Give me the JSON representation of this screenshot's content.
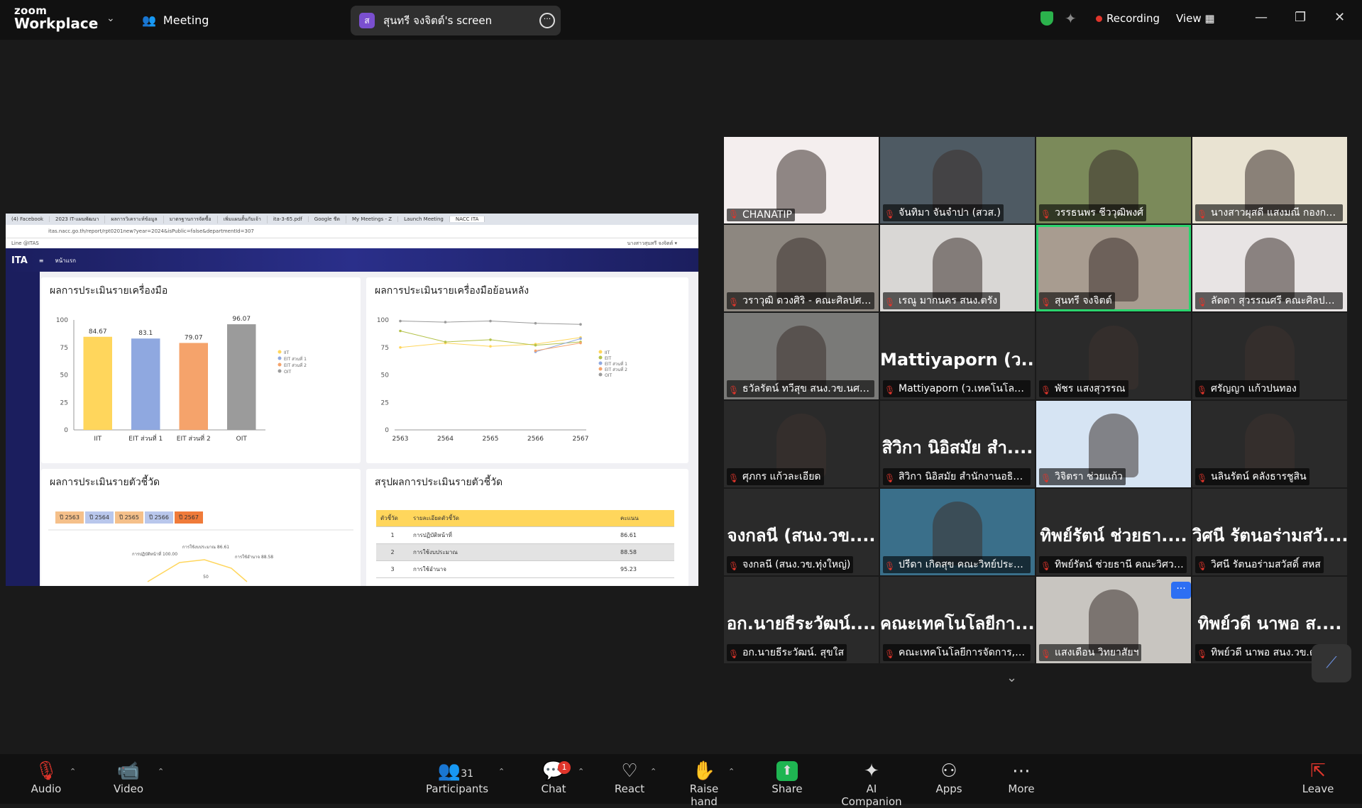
{
  "app": {
    "logo_top": "zoom",
    "logo_bottom": "Workplace",
    "meeting_label": "Meeting"
  },
  "screen_share": {
    "avatar": "ส",
    "title": "สุนทรี จงจิตต์'s screen"
  },
  "header_right": {
    "recording": "Recording",
    "view": "View"
  },
  "browser": {
    "tabs": [
      "(4) Facebook",
      "2023 IT-แผนพัฒนา",
      "ผลการวิเคราะห์ข้อมูล",
      "มาตรฐานการจัดซื้อ",
      "เพิ่มแผนสั้นกับเจ้า",
      "ita-3-65.pdf",
      "Google ชีต",
      "My Meetings - Z",
      "Launch Meeting",
      "NACC ITA"
    ],
    "url": "itas.nacc.go.th/report/rpt0201new?year=2024&isPublic=false&departmentId=307",
    "bookmark": "Line @ITAS",
    "user": "นางสาวสุนทรี จงจิตต์ ▾",
    "nav_home": "หน้าแรก",
    "logo": "ITA"
  },
  "cards": {
    "c1_title": "ผลการประเมินรายเครื่องมือ",
    "c2_title": "ผลการประเมินรายเครื่องมือย้อนหลัง",
    "c3_title": "ผลการประเมินรายตัวชี้วัด",
    "c4_title": "สรุปผลการประเมินรายตัวชี้วัด"
  },
  "chart_data": [
    {
      "type": "bar",
      "categories": [
        "IIT",
        "EIT ส่วนที่ 1",
        "EIT ส่วนที่ 2",
        "OIT"
      ],
      "values": [
        84.67,
        83.1,
        79.07,
        96.07
      ],
      "colors": [
        "#ffd65c",
        "#8fa8e0",
        "#f5a36b",
        "#9b9b9b"
      ],
      "legend": [
        "IIT",
        "EIT ส่วนที่ 1",
        "EIT ส่วนที่ 2",
        "OIT"
      ],
      "yticks": [
        0,
        25,
        50,
        75,
        100
      ],
      "ylim": [
        0,
        100
      ]
    },
    {
      "type": "line",
      "x": [
        "2563",
        "2564",
        "2565",
        "2566",
        "2567"
      ],
      "series": [
        {
          "name": "IIT",
          "values": [
            75,
            79,
            76,
            78,
            84
          ],
          "color": "#ffd65c"
        },
        {
          "name": "EIT",
          "values": [
            90,
            80,
            82,
            77,
            80
          ],
          "color": "#b4c24a"
        },
        {
          "name": "EIT ส่วนที่ 1",
          "values": [
            null,
            null,
            null,
            71,
            83
          ],
          "color": "#8fa8e0"
        },
        {
          "name": "EIT ส่วนที่ 2",
          "values": [
            null,
            null,
            null,
            72,
            79
          ],
          "color": "#f5a36b"
        },
        {
          "name": "OIT",
          "values": [
            99,
            98,
            99,
            97,
            96
          ],
          "color": "#9b9b9b"
        }
      ],
      "yticks": [
        0,
        25,
        50,
        75,
        100
      ],
      "ylim": [
        0,
        100
      ]
    }
  ],
  "year_buttons": [
    {
      "label": "ปี 2563",
      "color": "#f5c08a"
    },
    {
      "label": "ปี 2564",
      "color": "#b9c7ec"
    },
    {
      "label": "ปี 2565",
      "color": "#f5c08a"
    },
    {
      "label": "ปี 2566",
      "color": "#b9c7ec"
    },
    {
      "label": "ปี 2567",
      "color": "#f07b3a"
    }
  ],
  "radar_labels": [
    "การปฏิบัติหน้าที่ 100.00",
    "การใช้งบประมาณ 86.61",
    "การใช้อำนาจ 88.58",
    "50"
  ],
  "summary_table": {
    "headers": [
      "ตัวชี้วัด",
      "รายละเอียดตัวชี้วัด",
      "คะแนน"
    ],
    "rows": [
      [
        "1",
        "การปฏิบัติหน้าที่",
        "86.61"
      ],
      [
        "2",
        "การใช้งบประมาณ",
        "88.58"
      ],
      [
        "3",
        "การใช้อำนาจ",
        "95.23"
      ]
    ]
  },
  "participants": [
    {
      "name": "CHANATIP",
      "big": "",
      "bg": "#f4eeee"
    },
    {
      "name": "จันทิมา จันจำปา (สวส.)",
      "big": "",
      "bg": "#4e5a63"
    },
    {
      "name": "วรรธนพร ชีววุฒิพงศ์",
      "big": "",
      "bg": "#7b8a5a"
    },
    {
      "name": "นางสาวผุสดี แสงมณี กองกลาง",
      "big": "",
      "bg": "#e9e3d2"
    },
    {
      "name": "วราวุฒิ ดวงศิริ - คณะศิลปศาส...",
      "big": "",
      "bg": "#8d8780"
    },
    {
      "name": "เรณู มากนคร สนง.ตรัง",
      "big": "",
      "bg": "#d9d7d5"
    },
    {
      "name": "สุนทรี จงจิตต์",
      "big": "",
      "bg": "#a89c90"
    },
    {
      "name": "ลัดดา สุวรรณศรี คณะศิลปศา...",
      "big": "",
      "bg": "#e8e4e4"
    },
    {
      "name": "ธวัลรัตน์ ทวีสุข สนง.วข.นศ. ไ...",
      "big": "",
      "bg": "#7a7a78"
    },
    {
      "name": "Mattiyaporn (ว.เทคโนโลยีอุ...",
      "big": "Mattiyaporn (ว....",
      "bg": "#2a2a2a"
    },
    {
      "name": "พัชร แสงสุวรรณ",
      "big": "",
      "bg": "#2a2a2a"
    },
    {
      "name": "ศรัญญา แก้วปนทอง",
      "big": "",
      "bg": "#2a2a2a"
    },
    {
      "name": "ศุภกร แก้วละเอียด",
      "big": "",
      "bg": "#2a2a2a"
    },
    {
      "name": "สิวิกา นิอิสมัย สำนักงานอธิการ...",
      "big": "สิวิกา นิอิสมัย สำ....",
      "bg": "#2a2a2a"
    },
    {
      "name": "วิจิตรา ช่วยแก้ว",
      "big": "",
      "bg": "#d6e4f3"
    },
    {
      "name": "นลินรัตน์ คลังธารชูสิน",
      "big": "",
      "bg": "#2a2a2a"
    },
    {
      "name": "จงกลนี (สนง.วข.ทุ่งใหญ่)",
      "big": "จงกลนี (สนง.วข....",
      "bg": "#2a2a2a"
    },
    {
      "name": "ปรีดา เกิดสุข คณะวิทย์ประมง ...",
      "big": "",
      "bg": "#3a6f8a"
    },
    {
      "name": "ทิพย์รัตน์ ช่วยธานี คณะวิศวกร...",
      "big": "ทิพย์รัตน์ ช่วยธา....",
      "bg": "#2a2a2a"
    },
    {
      "name": "วิศนี รัตนอร่ามสวัสดิ์ สหส",
      "big": "วิศนี รัตนอร่ามสวั....",
      "bg": "#2a2a2a"
    },
    {
      "name": "อก.นายธีระวัฒน์. สุขใส",
      "big": "อก.นายธีระวัฒน์....",
      "bg": "#2a2a2a"
    },
    {
      "name": "คณะเทคโนโลยีการจัดการ,มทร....",
      "big": "คณะเทคโนโลยีกา....",
      "bg": "#2a2a2a"
    },
    {
      "name": "แสงเดือน วิทยาสัยฯ",
      "big": "",
      "bg": "#c8c5c0"
    },
    {
      "name": "ทิพย์วดี นาพอ สนง.วข.ตรัง",
      "big": "ทิพย์วดี นาพอ ส....",
      "bg": "#2a2a2a"
    }
  ],
  "toolbar": {
    "audio": "Audio",
    "video": "Video",
    "participants": "Participants",
    "participants_count": "31",
    "chat": "Chat",
    "chat_badge": "1",
    "react": "React",
    "raise_hand": "Raise hand",
    "share": "Share",
    "ai_companion": "AI Companion",
    "apps": "Apps",
    "more": "More",
    "leave": "Leave"
  }
}
